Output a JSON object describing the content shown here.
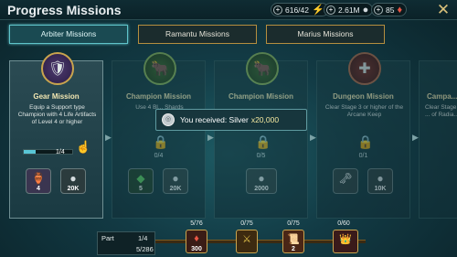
{
  "header": {
    "title": "Progress Missions",
    "energy": "616/42",
    "silver": "2.61M",
    "gems": "85"
  },
  "tabs": [
    {
      "label": "Arbiter Missions",
      "active": true
    },
    {
      "label": "Ramantu Missions",
      "active": false
    },
    {
      "label": "Marius Missions",
      "active": false
    }
  ],
  "cards": [
    {
      "title": "Gear Mission",
      "desc": "Equip a Support type Champion with 4 Life Artifacts of Level 4 or higher",
      "progress": "1/4",
      "progress_fraction": 0.25,
      "rewards": [
        "4",
        "20K"
      ]
    },
    {
      "title": "Champion Mission",
      "desc": "Use 4 Bl... Shards",
      "progress": "0/4",
      "rewards": [
        "5",
        "20K"
      ]
    },
    {
      "title": "Champion Mission",
      "desc": "",
      "progress": "0/5",
      "rewards": [
        "",
        "2000"
      ]
    },
    {
      "title": "Dungeon Mission",
      "desc": "Clear Stage 3 or higher of the Arcane Keep",
      "progress": "0/1",
      "rewards": [
        "",
        "10K"
      ]
    },
    {
      "title": "Campa...",
      "desc": "Clear Stage ... of Radia...",
      "progress": "",
      "rewards": [
        "",
        ""
      ]
    }
  ],
  "popup": {
    "prefix": "You received: Silver",
    "amount": "x20,000"
  },
  "bottom": {
    "part_label": "Part",
    "part_value": "1/4",
    "points": "5/286",
    "milestones": [
      {
        "count": "5/76",
        "value": "300"
      },
      {
        "count": "0/75",
        "value": ""
      },
      {
        "count": "0/75",
        "value": "2"
      },
      {
        "count": "0/60",
        "value": ""
      }
    ]
  }
}
